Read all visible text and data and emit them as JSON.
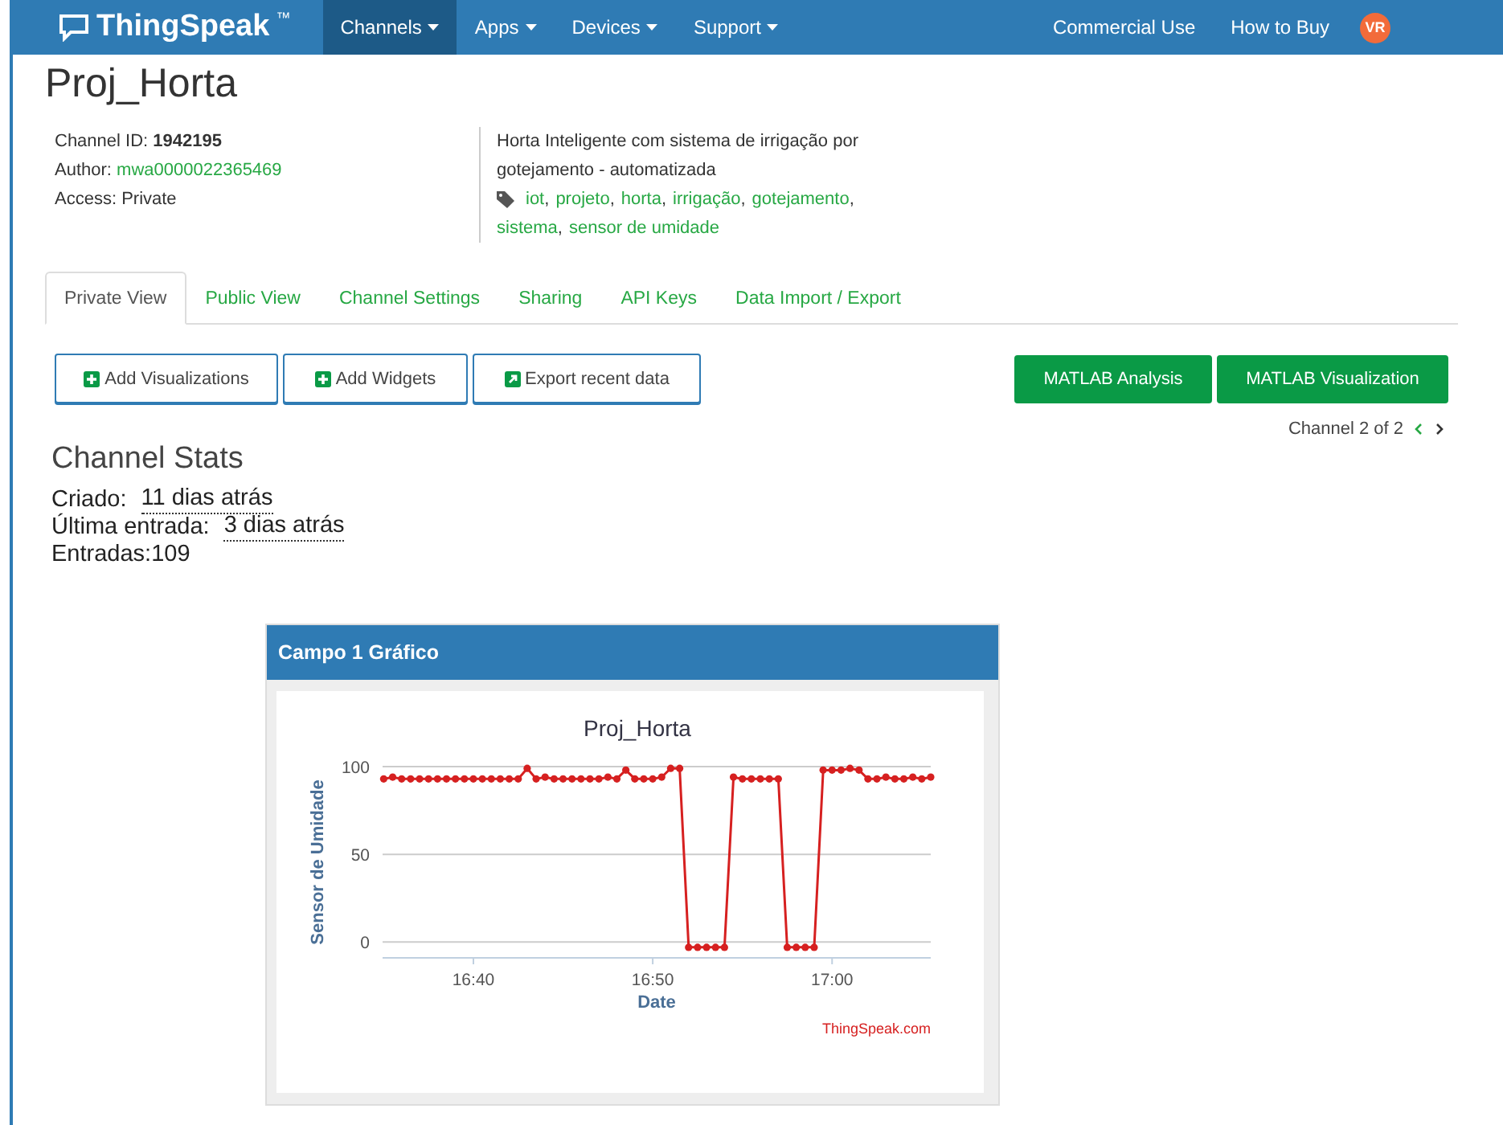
{
  "navbar": {
    "logo": "ThingSpeak",
    "trademark": "™",
    "menus": [
      {
        "label": "Channels",
        "selected": true
      },
      {
        "label": "Apps",
        "selected": false
      },
      {
        "label": "Devices",
        "selected": false
      },
      {
        "label": "Support",
        "selected": false
      }
    ],
    "links": [
      "Commercial Use",
      "How to Buy"
    ],
    "avatar": "VR"
  },
  "channel": {
    "title": "Proj_Horta",
    "id_label": "Channel ID:",
    "id": "1942195",
    "author_label": "Author:",
    "author": "mwa0000022365469",
    "access": "Access: Private",
    "description": "Horta Inteligente com sistema de irrigação por gotejamento - automatizada",
    "tags": [
      {
        "label": "iot",
        "separator": ","
      },
      {
        "label": "projeto",
        "separator": ","
      },
      {
        "label": "horta",
        "separator": ","
      },
      {
        "label": "irrigação",
        "separator": ","
      },
      {
        "label": "gotejamento",
        "separator": ","
      },
      {
        "label": "sistema",
        "separator": ","
      },
      {
        "label": "sensor de umidade"
      }
    ]
  },
  "tabs": [
    {
      "label": "Private View",
      "selected": true
    },
    {
      "label": "Public View",
      "selected": false
    },
    {
      "label": "Channel Settings",
      "selected": false
    },
    {
      "label": "Sharing",
      "selected": false
    },
    {
      "label": "API Keys",
      "selected": false
    },
    {
      "label": "Data Import / Export",
      "selected": false
    }
  ],
  "actions": [
    {
      "label": "Add Visualizations",
      "kind": "plus"
    },
    {
      "label": "Add Widgets",
      "kind": "plus"
    },
    {
      "label": "Export recent data",
      "kind": "export"
    }
  ],
  "matlab_buttons": [
    "MATLAB Analysis",
    "MATLAB Visualization"
  ],
  "pager": "Channel 2 of 2",
  "stats": {
    "title": "Channel Stats",
    "items": [
      {
        "label": "Criado:",
        "value": "11 dias atrás",
        "kind": "time"
      },
      {
        "label": "Última entrada:",
        "value": "3 dias atrás",
        "kind": "time"
      },
      {
        "label": "Entradas:",
        "value": "109",
        "kind": "count"
      }
    ]
  },
  "chart_card": {
    "title": "Campo 1 Gráfico",
    "credit": "ThingSpeak.com",
    "chart_data": {
      "type": "line",
      "title": "Proj_Horta",
      "xlabel": "Date",
      "ylabel": "Sensor de Umidade",
      "categories": [
        null,
        null,
        null,
        null,
        null,
        null,
        null,
        null,
        null,
        null,
        "16:40",
        null,
        null,
        null,
        null,
        null,
        null,
        null,
        null,
        null,
        null,
        null,
        null,
        null,
        null,
        null,
        null,
        null,
        null,
        null,
        "16:50",
        null,
        null,
        null,
        null,
        null,
        null,
        null,
        null,
        null,
        null,
        null,
        null,
        null,
        null,
        null,
        null,
        null,
        null,
        null,
        "17:00",
        null,
        null,
        null,
        null,
        null,
        null,
        null,
        null,
        null,
        null,
        null
      ],
      "series": [
        {
          "color": "#d62020",
          "marker": "circle",
          "values": [
            93,
            94,
            93,
            93,
            93,
            93,
            93,
            93,
            93,
            93,
            93,
            93,
            93,
            93,
            93,
            93,
            99,
            93,
            94,
            93,
            93,
            93,
            93,
            93,
            93,
            94,
            93,
            98,
            93,
            93,
            93,
            94,
            99,
            99,
            -3,
            -3,
            -3,
            -3,
            -3,
            94,
            93,
            93,
            93,
            93,
            93,
            -3,
            -3,
            -3,
            -3,
            98,
            98,
            98,
            99,
            98,
            93,
            93,
            94,
            93,
            93,
            94,
            93,
            94
          ]
        }
      ],
      "ylim": [
        -9,
        100
      ],
      "yticks": [
        0,
        50,
        100
      ]
    }
  }
}
